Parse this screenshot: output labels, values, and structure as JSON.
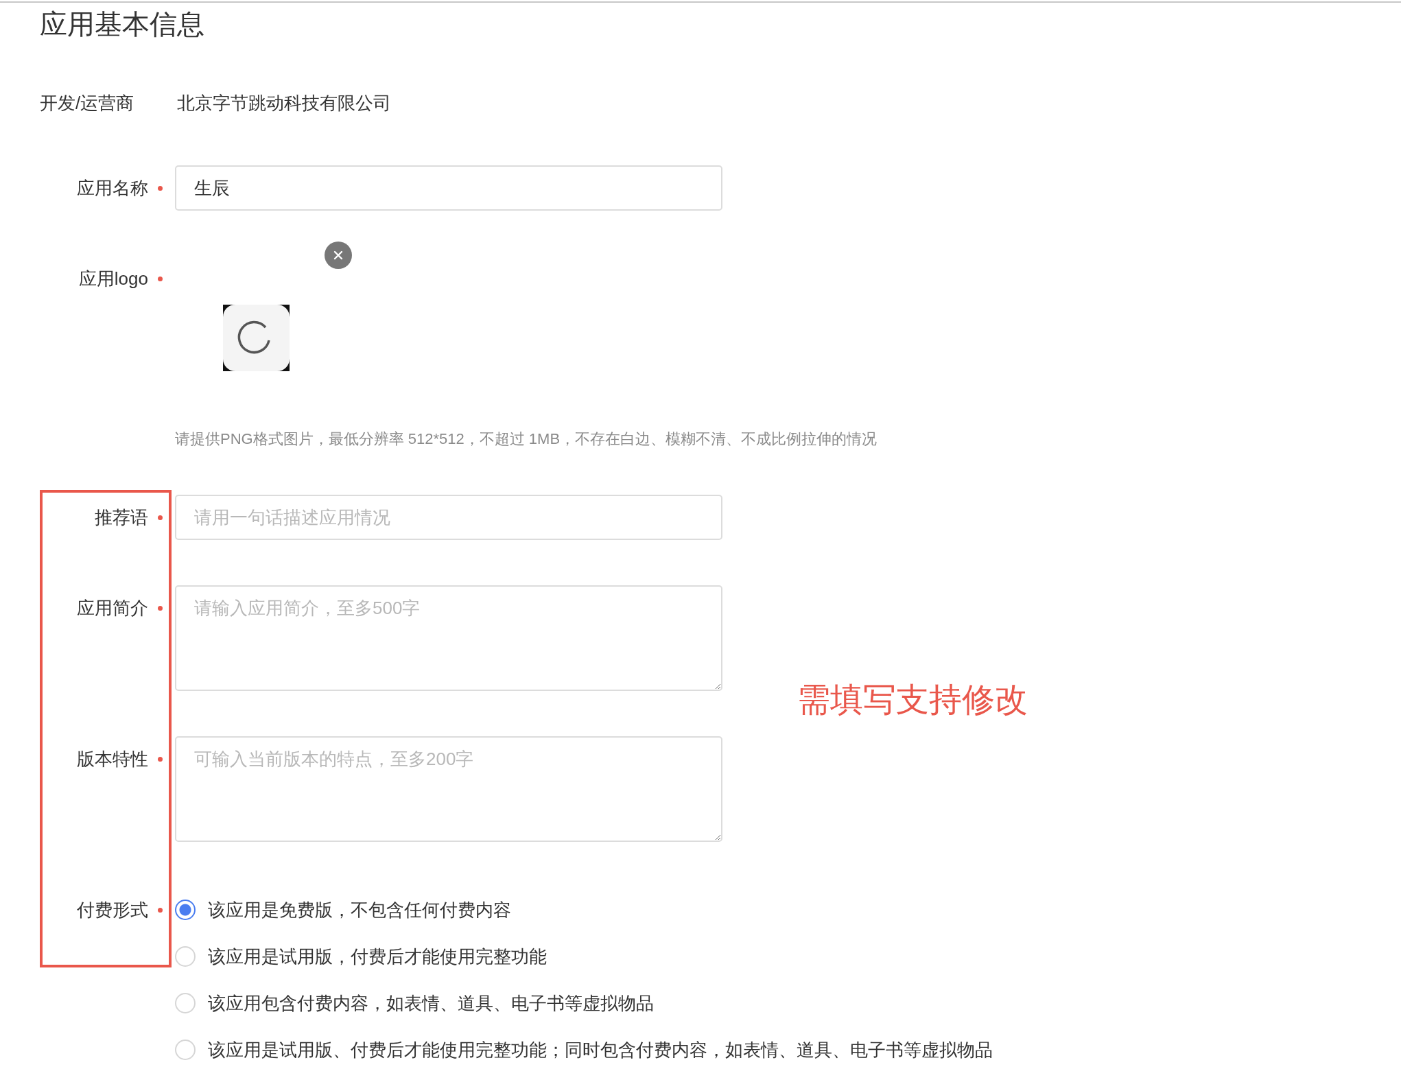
{
  "section_title": "应用基本信息",
  "developer": {
    "label": "开发/运营商",
    "value": "北京字节跳动科技有限公司"
  },
  "fields": [
    {
      "kind": "input",
      "label": "应用名称",
      "required": true,
      "value": "生辰"
    },
    {
      "kind": "logo",
      "label": "应用logo",
      "required": true,
      "hint": "请提供PNG格式图片，最低分辨率 512*512，不超过 1MB，不存在白边、模糊不清、不成比例拉伸的情况"
    },
    {
      "kind": "input",
      "label": "推荐语",
      "required": true,
      "placeholder": "请用一句话描述应用情况"
    },
    {
      "kind": "textarea",
      "label": "应用简介",
      "required": true,
      "placeholder": "请输入应用简介，至多500字"
    },
    {
      "kind": "textarea",
      "label": "版本特性",
      "required": true,
      "placeholder": "可输入当前版本的特点，至多200字"
    },
    {
      "kind": "radio",
      "label": "付费形式",
      "required": true,
      "options": [
        {
          "label": "该应用是免费版，不包含任何付费内容",
          "selected": true
        },
        {
          "label": "该应用是试用版，付费后才能使用完整功能",
          "selected": false
        },
        {
          "label": "该应用包含付费内容，如表情、道具、电子书等虚拟物品",
          "selected": false
        },
        {
          "label": "该应用是试用版、付费后才能使用完整功能；同时包含付费内容，如表情、道具、电子书等虚拟物品",
          "selected": false
        }
      ]
    }
  ],
  "annotation": {
    "text": "需填写支持修改"
  }
}
